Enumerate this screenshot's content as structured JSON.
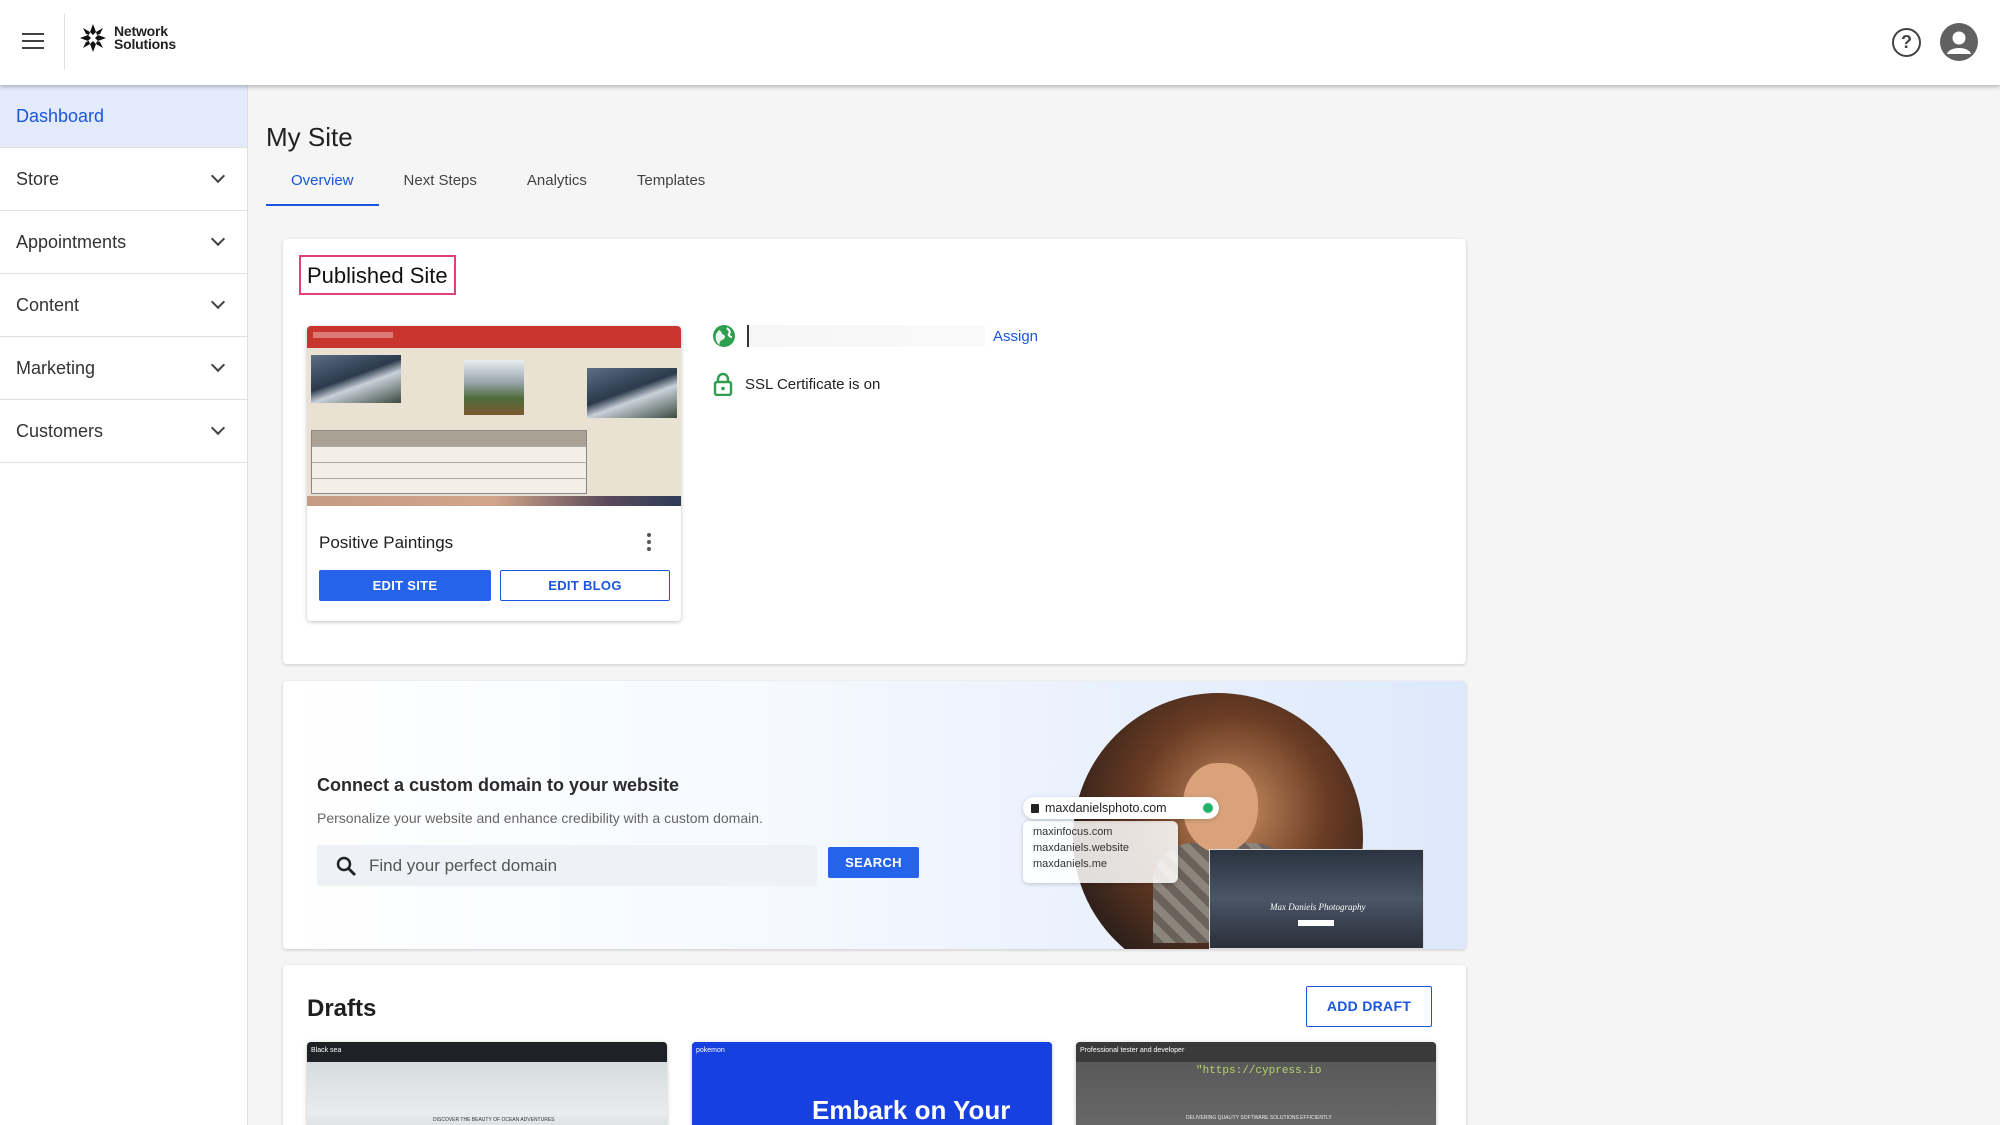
{
  "header": {
    "brand_line1": "Network",
    "brand_line2": "Solutions",
    "help_glyph": "?"
  },
  "sidebar": {
    "items": [
      {
        "label": "Dashboard",
        "active": true
      },
      {
        "label": "Store"
      },
      {
        "label": "Appointments"
      },
      {
        "label": "Content"
      },
      {
        "label": "Marketing"
      },
      {
        "label": "Customers"
      }
    ]
  },
  "main": {
    "title": "My Site",
    "tabs": [
      {
        "label": "Overview",
        "active": true
      },
      {
        "label": "Next Steps"
      },
      {
        "label": "Analytics"
      },
      {
        "label": "Templates"
      }
    ]
  },
  "published": {
    "title": "Published Site",
    "site_name": "Positive Paintings",
    "edit_site_label": "EDIT SITE",
    "edit_blog_label": "EDIT BLOG",
    "assign_label": "Assign",
    "ssl_text": "SSL Certificate is on"
  },
  "promo": {
    "title": "Connect a custom domain to your website",
    "subtitle": "Personalize your website and enhance credibility with a custom domain.",
    "search_placeholder": "Find your perfect domain",
    "search_button": "SEARCH",
    "example_domain": "maxdanielsphoto.com",
    "alt_domains": [
      "maxinfocus.com",
      "maxdaniels.website",
      "maxdaniels.me"
    ],
    "mock_site_title": "Max Daniels Photography"
  },
  "drafts": {
    "title": "Drafts",
    "add_label": "ADD DRAFT",
    "items": [
      {
        "name": "Black sea",
        "caption": "DISCOVER THE BEAUTY OF OCEAN ADVENTURES"
      },
      {
        "name": "pokemon",
        "hero": "Embark on Your"
      },
      {
        "name": "Professional tester and developer",
        "code": "\"https://cypress.io",
        "caption": "DELIVERING QUALITY SOFTWARE SOLUTIONS EFFICIENTLY"
      }
    ]
  },
  "colors": {
    "accent": "#1a56db",
    "primary_button": "#2563eb",
    "highlight_border": "#e0407a",
    "ssl_green": "#2e9e4f"
  },
  "icons": [
    "menu-icon",
    "help-icon",
    "account-icon",
    "chevron-down-icon",
    "globe-icon",
    "lock-icon",
    "search-icon",
    "more-vert-icon"
  ]
}
